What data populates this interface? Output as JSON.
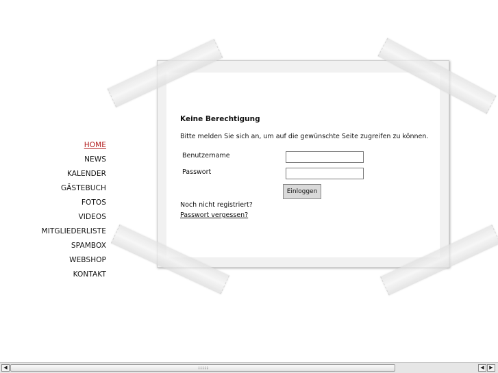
{
  "nav": {
    "items": [
      {
        "label": "HOME",
        "active": true
      },
      {
        "label": "NEWS"
      },
      {
        "label": "KALENDER"
      },
      {
        "label": "GÄSTEBUCH"
      },
      {
        "label": "FOTOS"
      },
      {
        "label": "VIDEOS"
      },
      {
        "label": "MITGLIEDERLISTE"
      },
      {
        "label": "SPAMBOX"
      },
      {
        "label": "WEBSHOP"
      },
      {
        "label": "KONTAKT"
      }
    ],
    "active_color": "#b01818"
  },
  "login": {
    "heading": "Keine Berechtigung",
    "intro": "Bitte melden Sie sich an, um auf die gewünschte Seite zugreifen zu können.",
    "username_label": "Benutzername",
    "username_value": "",
    "password_label": "Passwort",
    "password_value": "",
    "submit_label": "Einloggen",
    "not_registered": "Noch nicht registriert?",
    "forgot_password": "Passwort vergessen?"
  },
  "scrollbar": {
    "left_arrow": "◀",
    "right_arrow_1": "◀",
    "right_arrow_2": "▶"
  }
}
